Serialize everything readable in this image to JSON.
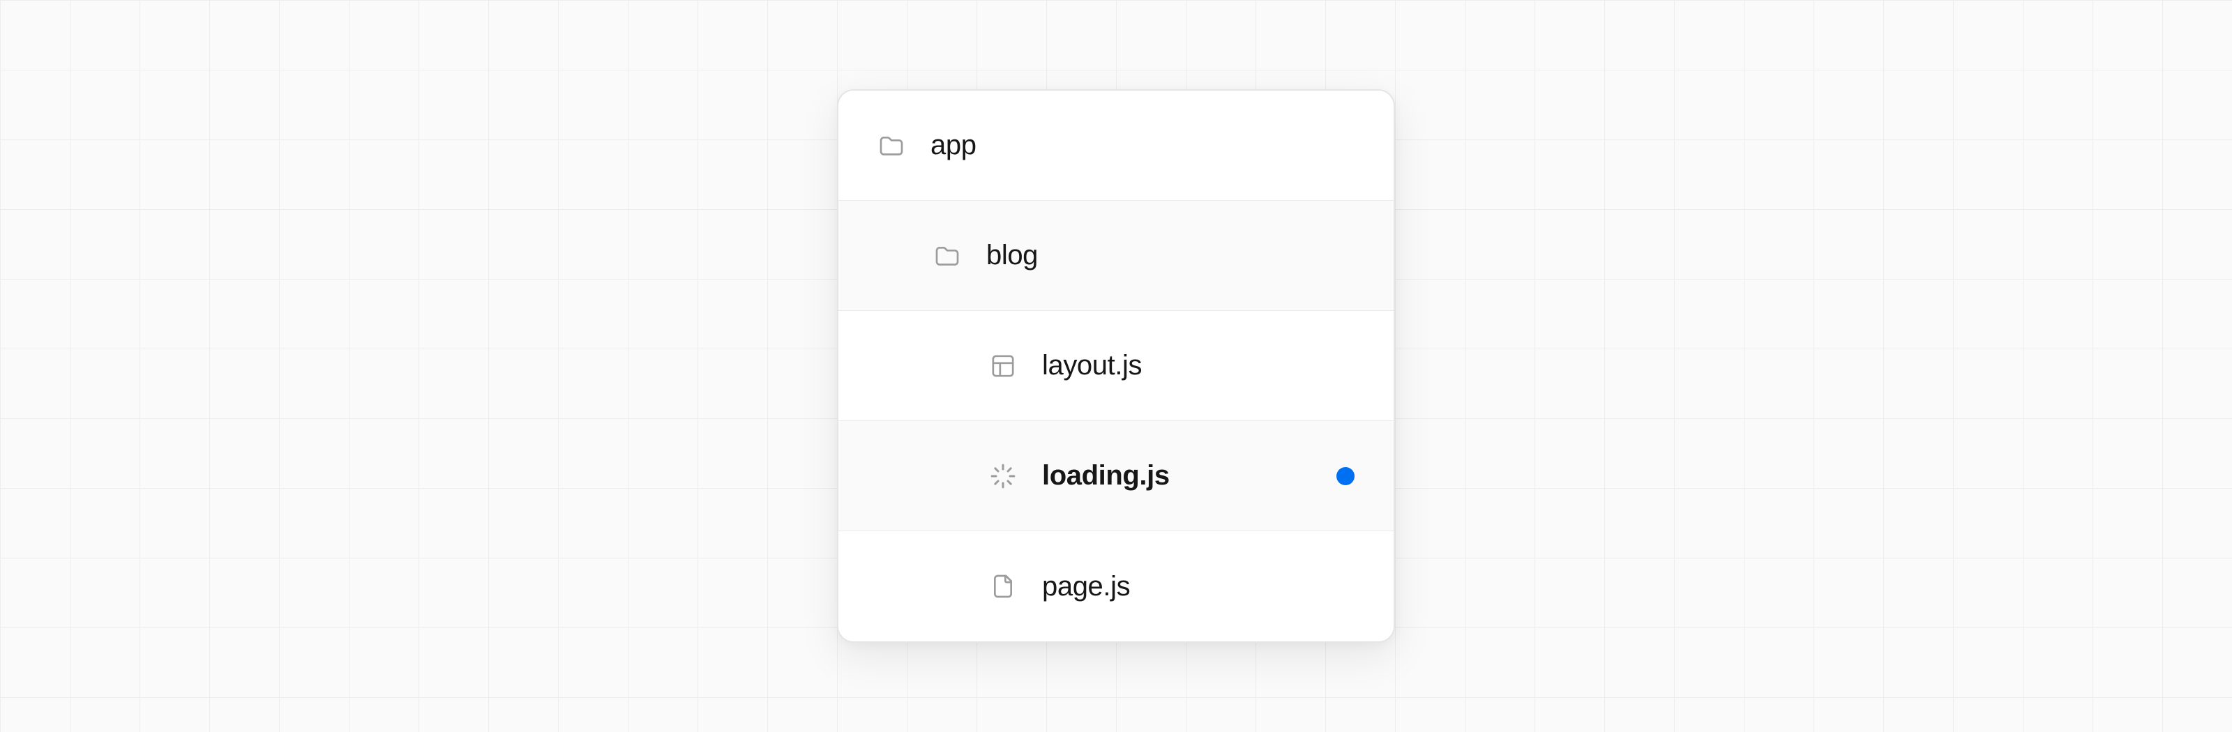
{
  "colors": {
    "accent": "#0070f3",
    "icon": "#9c9c9c",
    "text": "#171717",
    "border": "#ebebeb",
    "bg": "#fafafa"
  },
  "tree": {
    "root": {
      "label": "app",
      "icon": "folder-icon"
    },
    "folder1": {
      "label": "blog",
      "icon": "folder-icon"
    },
    "file1": {
      "label": "layout.js",
      "icon": "layout-icon"
    },
    "file2": {
      "label": "loading.js",
      "icon": "loading-icon",
      "highlighted": true
    },
    "file3": {
      "label": "page.js",
      "icon": "file-icon"
    }
  }
}
